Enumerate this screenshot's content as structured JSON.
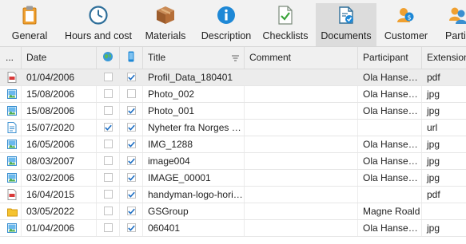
{
  "toolbar": {
    "items": [
      {
        "label": "General",
        "icon": "clipboard-icon"
      },
      {
        "label": "Hours and cost",
        "icon": "clock-icon"
      },
      {
        "label": "Materials",
        "icon": "box-icon"
      },
      {
        "label": "Description",
        "icon": "info-icon"
      },
      {
        "label": "Checklists",
        "icon": "checklist-icon"
      },
      {
        "label": "Documents",
        "icon": "documents-icon",
        "active": true
      },
      {
        "label": "Customer",
        "icon": "customer-icon"
      },
      {
        "label": "Partic",
        "icon": "participants-icon"
      }
    ]
  },
  "grid": {
    "columns": {
      "type": "...",
      "date": "Date",
      "web": "globe-icon",
      "mobile": "phone-icon",
      "title": "Title",
      "comment": "Comment",
      "participant": "Participant",
      "extension": "Extension"
    },
    "rows": [
      {
        "icon": "pdf-file-icon",
        "date": "01/04/2006",
        "web": false,
        "mobile": true,
        "title": "Profil_Data_180401",
        "comment": "",
        "participant": "Ola Hansen jr",
        "extension": "pdf",
        "selected": true
      },
      {
        "icon": "image-file-icon",
        "date": "15/08/2006",
        "web": false,
        "mobile": false,
        "title": "Photo_002",
        "comment": "",
        "participant": "Ola Hansen jr",
        "extension": "jpg"
      },
      {
        "icon": "image-file-icon",
        "date": "15/08/2006",
        "web": false,
        "mobile": true,
        "title": "Photo_001",
        "comment": "",
        "participant": "Ola Hansen jr",
        "extension": "jpg"
      },
      {
        "icon": "url-file-icon",
        "date": "15/07/2020",
        "web": true,
        "mobile": true,
        "title": "Nyheter fra Norges m...",
        "comment": "",
        "participant": "",
        "extension": "url"
      },
      {
        "icon": "image-file-icon",
        "date": "16/05/2006",
        "web": false,
        "mobile": true,
        "title": "IMG_1288",
        "comment": "",
        "participant": "Ola Hansen jr",
        "extension": "jpg"
      },
      {
        "icon": "image-file-icon",
        "date": "08/03/2007",
        "web": false,
        "mobile": true,
        "title": "image004",
        "comment": "",
        "participant": "Ola Hansen jr",
        "extension": "jpg"
      },
      {
        "icon": "image-file-icon",
        "date": "03/02/2006",
        "web": false,
        "mobile": true,
        "title": "IMAGE_00001",
        "comment": "",
        "participant": "Ola Hansen jr",
        "extension": "jpg"
      },
      {
        "icon": "pdf-file-icon",
        "date": "16/04/2015",
        "web": false,
        "mobile": true,
        "title": "handyman-logo-horiz...",
        "comment": "",
        "participant": "",
        "extension": "pdf"
      },
      {
        "icon": "folder-icon",
        "date": "03/05/2022",
        "web": false,
        "mobile": true,
        "title": "GSGroup",
        "comment": "",
        "participant": "Magne Roald",
        "extension": ""
      },
      {
        "icon": "image-file-icon",
        "date": "01/04/2006",
        "web": false,
        "mobile": true,
        "title": "060401",
        "comment": "",
        "participant": "Ola Hansen jr",
        "extension": "jpg"
      }
    ]
  },
  "colors": {
    "accent": "#1e88d6",
    "check": "#1e6fc4",
    "toolbar_bg": "#f2f2f2",
    "active_tab": "#dcdcdc",
    "selected_row": "#ececec"
  }
}
